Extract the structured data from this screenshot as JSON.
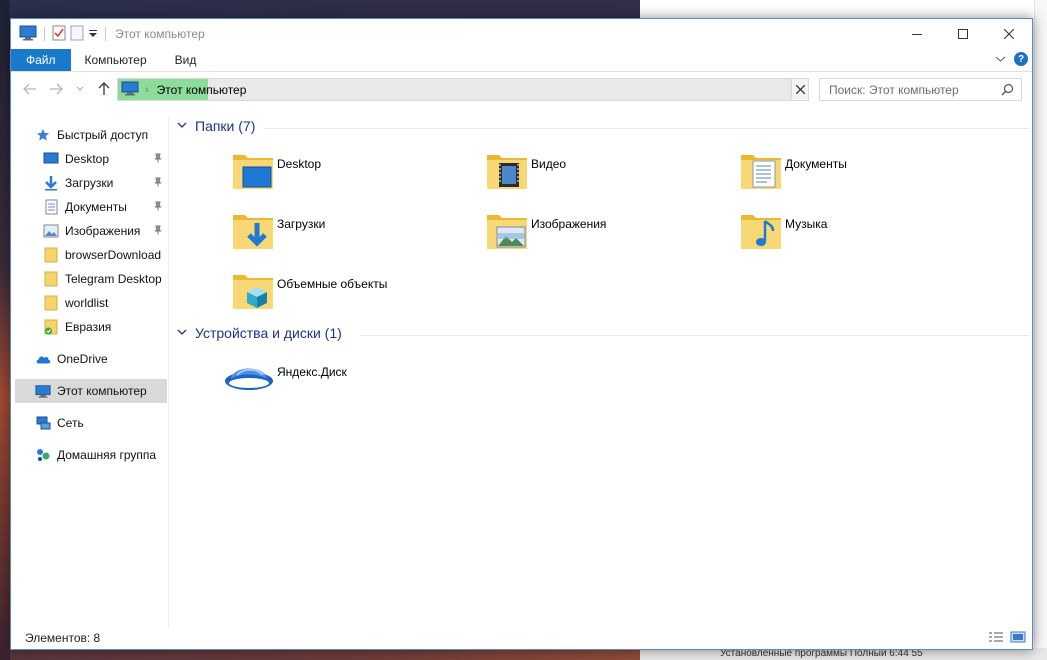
{
  "window": {
    "title": "Этот компьютер",
    "ribbon_tabs": [
      "Файл",
      "Компьютер",
      "Вид"
    ],
    "help_label": "?"
  },
  "address": {
    "location": "Этот компьютер",
    "search_placeholder": "Поиск: Этот компьютер"
  },
  "sidebar": {
    "items": [
      {
        "label": "Быстрый доступ",
        "icon": "star-icon"
      },
      {
        "label": "Desktop",
        "icon": "desktop-icon",
        "pinned": true
      },
      {
        "label": "Загрузки",
        "icon": "download-icon",
        "pinned": true
      },
      {
        "label": "Документы",
        "icon": "document-icon",
        "pinned": true
      },
      {
        "label": "Изображения",
        "icon": "image-icon",
        "pinned": true
      },
      {
        "label": "browserDownload",
        "icon": "folder-icon"
      },
      {
        "label": "Telegram Desktop",
        "icon": "folder-icon"
      },
      {
        "label": "worldlist",
        "icon": "folder-icon"
      },
      {
        "label": "Евразия",
        "icon": "folder-sync-icon"
      },
      {
        "label": "OneDrive",
        "icon": "cloud-icon"
      },
      {
        "label": "Этот компьютер",
        "icon": "computer-icon",
        "selected": true
      },
      {
        "label": "Сеть",
        "icon": "network-icon"
      },
      {
        "label": "Домашняя группа",
        "icon": "homegroup-icon"
      }
    ]
  },
  "content": {
    "folders_header": "Папки (7)",
    "folders": [
      {
        "label": "Desktop",
        "icon": "desktop-folder-icon"
      },
      {
        "label": "Видео",
        "icon": "video-folder-icon"
      },
      {
        "label": "Документы",
        "icon": "documents-folder-icon"
      },
      {
        "label": "Загрузки",
        "icon": "downloads-folder-icon"
      },
      {
        "label": "Изображения",
        "icon": "pictures-folder-icon"
      },
      {
        "label": "Музыка",
        "icon": "music-folder-icon"
      },
      {
        "label": "Объемные объекты",
        "icon": "3d-objects-folder-icon"
      }
    ],
    "devices_header": "Устройства и диски (1)",
    "devices": [
      {
        "label": "Яндекс.Диск",
        "icon": "yandex-disk-icon"
      }
    ]
  },
  "status": {
    "items_count": "Элементов: 8"
  },
  "background_window": {
    "bottom_text": "Установленные программы  Полный  6:44 55"
  },
  "colors": {
    "accent": "#1979ca",
    "header": "#1e3287",
    "folder": "#f5d46b"
  }
}
